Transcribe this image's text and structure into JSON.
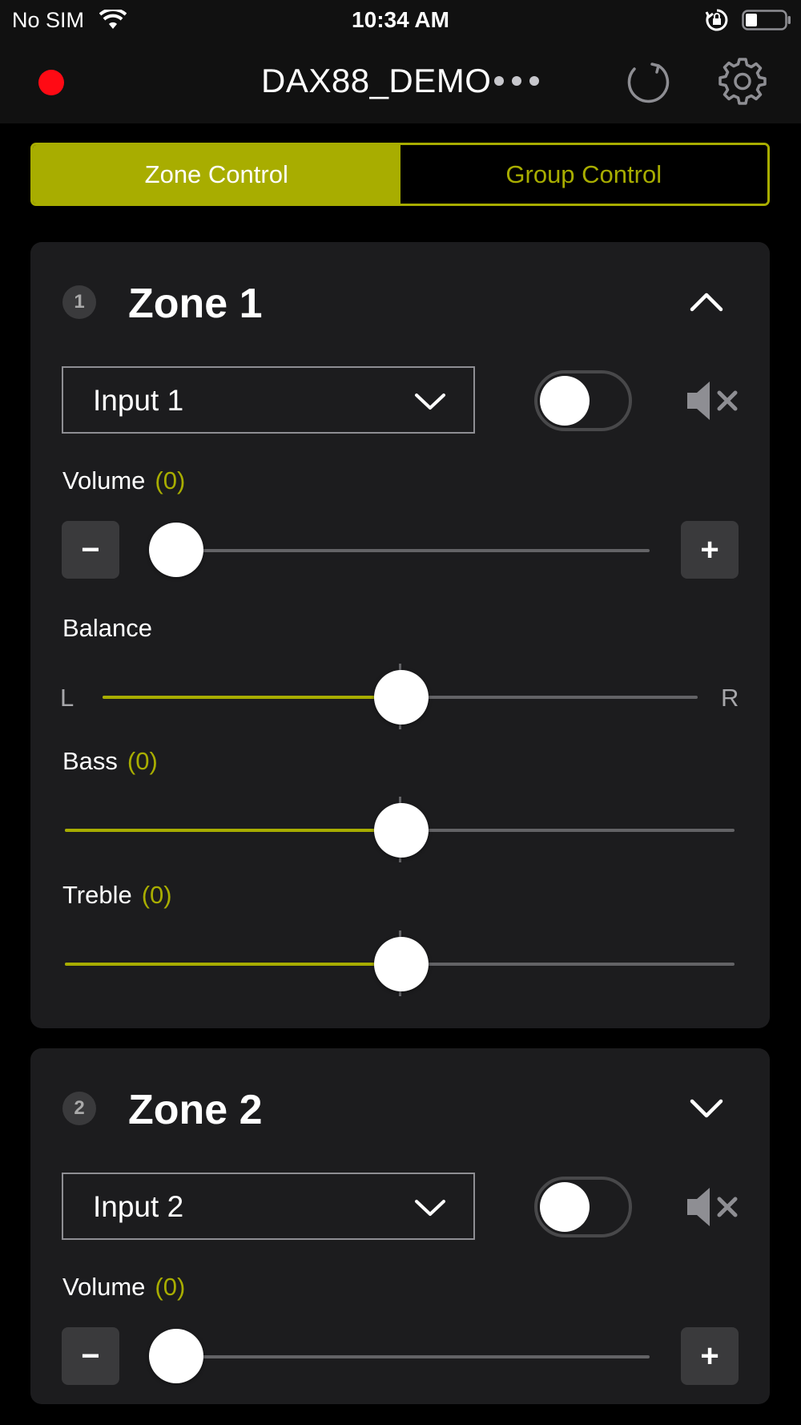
{
  "status_bar": {
    "carrier": "No SIM",
    "time": "10:34 AM"
  },
  "nav": {
    "title": "DAX88_DEMO",
    "icons": [
      "record-dot",
      "more-icon",
      "refresh-icon",
      "gear-icon"
    ]
  },
  "tabs": [
    {
      "label": "Zone Control",
      "selected": true
    },
    {
      "label": "Group Control",
      "selected": false
    }
  ],
  "colors": {
    "accent": "#a8ad00",
    "record": "#ff0a14",
    "card": "#1c1c1e"
  },
  "zones": [
    {
      "number": "1",
      "name": "Zone 1",
      "expanded": true,
      "input": "Input 1",
      "power_on": false,
      "muted": true,
      "volume": {
        "label": "Volume",
        "value_text": "(0)",
        "level": 0.05
      },
      "balance": {
        "label": "Balance",
        "left": "L",
        "right": "R",
        "level": 0.5
      },
      "bass": {
        "label": "Bass",
        "value_text": "(0)",
        "level": 0.5
      },
      "treble": {
        "label": "Treble",
        "value_text": "(0)",
        "level": 0.5
      }
    },
    {
      "number": "2",
      "name": "Zone 2",
      "expanded": false,
      "input": "Input 2",
      "power_on": false,
      "muted": true,
      "volume": {
        "label": "Volume",
        "value_text": "(0)",
        "level": 0.05
      }
    }
  ],
  "buttons": {
    "minus": "−",
    "plus": "+"
  }
}
